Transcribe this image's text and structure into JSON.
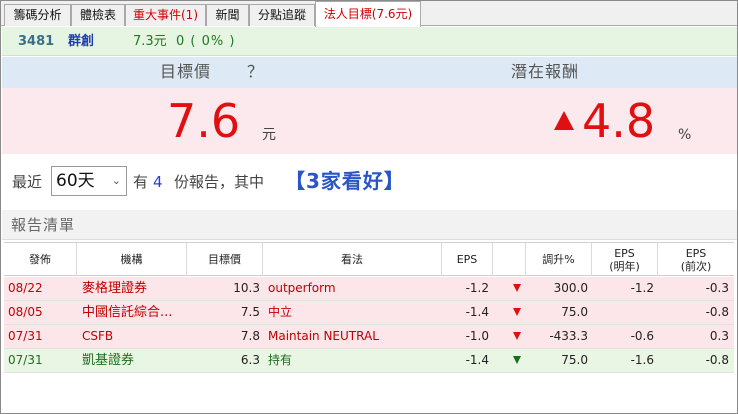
{
  "tabs": [
    {
      "label": "籌碼分析"
    },
    {
      "label": "體檢表"
    },
    {
      "label": "重大事件(1)"
    },
    {
      "label": "新聞"
    },
    {
      "label": "分點追蹤"
    },
    {
      "label": "法人目標(7.6元)"
    }
  ],
  "stock": {
    "code": "3481",
    "name": "群創",
    "price": "7.3元",
    "change": "0 ( 0% )"
  },
  "summary": {
    "target_label": "目標價",
    "help_glyph": "？",
    "potential_label": "潛在報酬",
    "target_value": "7.6",
    "target_unit": "元",
    "potential_value": "4.8",
    "potential_unit": "%"
  },
  "filter": {
    "recent_label": "最近",
    "period_value": "60天",
    "have_label": "有",
    "report_count": "4",
    "rest_label": "份報告，其中",
    "bullish_text": "【3家看好】"
  },
  "list_title": "報告清單",
  "columns": [
    "發佈",
    "機構",
    "目標價",
    "看法",
    "EPS",
    "",
    "調升%",
    "EPS\n(明年)",
    "EPS\n(前次)"
  ],
  "colors": {
    "accent_red": "#e01010",
    "accent_blue": "#2a55c8",
    "row_red": "#fde6ea",
    "row_green": "#e8f6e3"
  },
  "rows": [
    {
      "date": "08/22",
      "broker": "麥格理證券",
      "target": "10.3",
      "view": "outperform",
      "eps": "-1.2",
      "arrow": "down-red",
      "up": "300.0",
      "eps_next": "-1.2",
      "eps_prev": "-0.3",
      "tone": "r"
    },
    {
      "date": "08/05",
      "broker": "中國信託綜合...",
      "target": "7.5",
      "view": "中立",
      "eps": "-1.4",
      "arrow": "down-red",
      "up": "75.0",
      "eps_next": "",
      "eps_prev": "-0.8",
      "tone": "r"
    },
    {
      "date": "07/31",
      "broker": "CSFB",
      "target": "7.8",
      "view": "Maintain NEUTRAL",
      "eps": "-1.0",
      "arrow": "down-red",
      "up": "-433.3",
      "eps_next": "-0.6",
      "eps_prev": "0.3",
      "tone": "r"
    },
    {
      "date": "07/31",
      "broker": "凱基證券",
      "target": "6.3",
      "view": "持有",
      "eps": "-1.4",
      "arrow": "down-green",
      "up": "75.0",
      "eps_next": "-1.6",
      "eps_prev": "-0.8",
      "tone": "g"
    }
  ]
}
